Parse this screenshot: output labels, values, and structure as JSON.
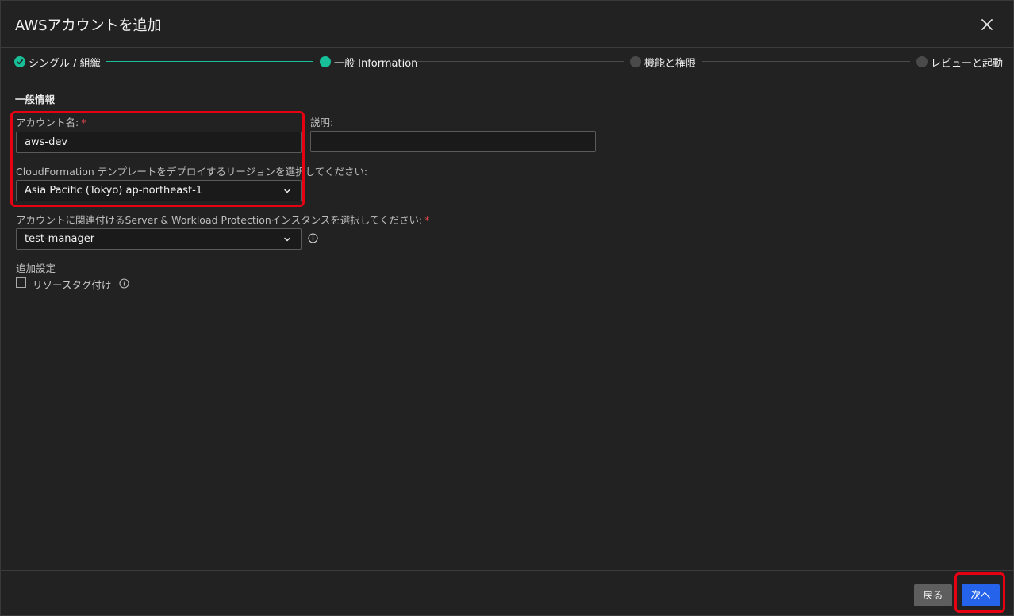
{
  "dialog": {
    "title": "AWSアカウントを追加"
  },
  "stepper": {
    "steps": [
      {
        "label": "シングル / 組織",
        "state": "done"
      },
      {
        "label": "一般 Information",
        "state": "active"
      },
      {
        "label": "機能と権限",
        "state": "pending"
      },
      {
        "label": "レビューと起動",
        "state": "pending"
      }
    ]
  },
  "form": {
    "section_title": "一般情報",
    "account_name": {
      "label": "アカウント名:",
      "required": "*",
      "value": "aws-dev"
    },
    "description": {
      "label": "説明:",
      "value": ""
    },
    "region": {
      "label": "CloudFormation テンプレートをデプロイするリージョンを選択してください:",
      "value": "Asia Pacific (Tokyo) ap-northeast-1"
    },
    "instance": {
      "label": "アカウントに関連付けるServer & Workload Protectionインスタンスを選択してください:",
      "required": "*",
      "value": "test-manager"
    },
    "additional": {
      "label": "追加設定",
      "resource_tag_label": "リソースタグ付け",
      "resource_tag_checked": false
    }
  },
  "footer": {
    "back_label": "戻る",
    "next_label": "次へ"
  },
  "colors": {
    "accent": "#18c09a",
    "primary_button": "#2563eb",
    "highlight": "#e60012",
    "required": "#e5484d"
  }
}
